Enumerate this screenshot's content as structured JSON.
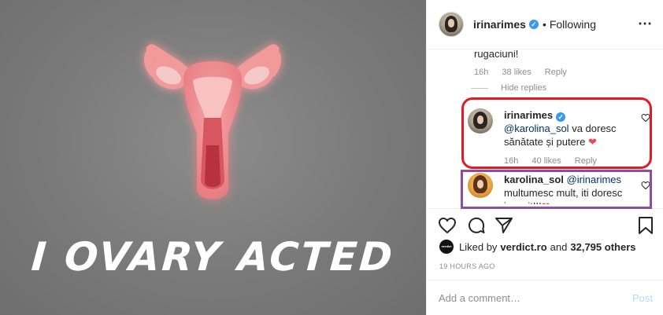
{
  "image": {
    "caption_text": "I OVARY ACTED"
  },
  "header": {
    "username": "irinarimes",
    "verified_mark": "✓",
    "separator": "•",
    "follow_state": "Following",
    "more_glyph": "⋯"
  },
  "comments": {
    "partial_text": "rugaciuni!",
    "parent_meta": {
      "time": "16h",
      "likes": "38 likes",
      "reply": "Reply"
    },
    "hide_replies": "Hide replies",
    "replies": [
      {
        "username": "irinarimes",
        "mention": "@karolina_sol",
        "text": " va doresc sănătate și putere ",
        "emoji": "❤",
        "time": "16h",
        "likes": "40 likes",
        "reply": "Reply"
      },
      {
        "username": "karolina_sol",
        "mention": "@irinarimes",
        "text": "multumesc mult, iti doresc inzecit!!!",
        "emoji": "❤"
      }
    ]
  },
  "likes_line": {
    "liked_by": "Liked by",
    "liker": "verdict.ro",
    "and": "and",
    "others": "32,795 others",
    "badge_text": "verdict"
  },
  "timestamp": "19 HOURS AGO",
  "add_comment": {
    "placeholder": "Add a comment…",
    "post_label": "Post"
  },
  "colors": {
    "highlight_red": "#e01b24",
    "highlight_purple": "#8d4ea1",
    "link": "#003569",
    "verified": "#3897f0"
  },
  "icons": [
    "heart-icon",
    "comment-icon",
    "share-icon",
    "bookmark-icon",
    "more-icon",
    "verified-icon"
  ]
}
